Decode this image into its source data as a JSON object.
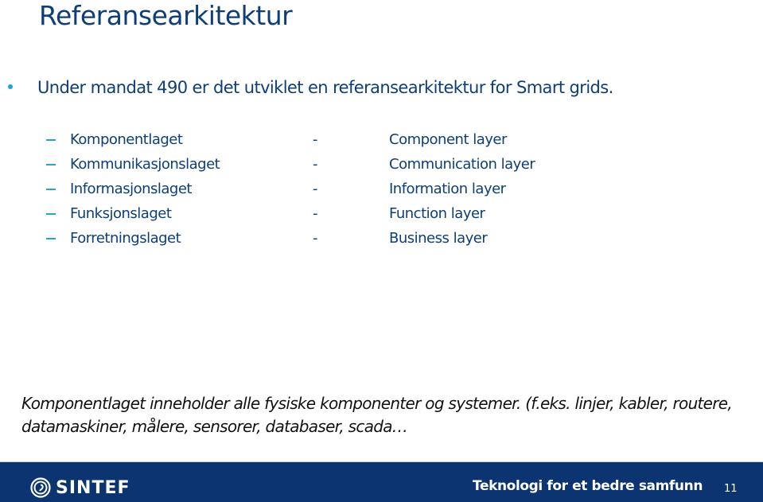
{
  "slide": {
    "title": "Referansearkitektur",
    "bullet": "Under mandat 490 er det utviklet en referansearkitektur for Smart grids.",
    "layers": [
      {
        "no": "Komponentlaget",
        "sep": "-",
        "en": "Component layer"
      },
      {
        "no": "Kommunikasjonslaget",
        "sep": "-",
        "en": "Communication layer"
      },
      {
        "no": "Informasjonslaget",
        "sep": "-",
        "en": "Information layer"
      },
      {
        "no": "Funksjonslaget",
        "sep": "-",
        "en": "Function layer"
      },
      {
        "no": "Forretningslaget",
        "sep": "-",
        "en": "Business layer"
      }
    ],
    "note_line1": "Komponentlaget inneholder alle fysiske komponenter og systemer. (f.eks. linjer, kabler, routere,",
    "note_line2": "datamaskiner, målere, sensorer, databaser, scada…"
  },
  "footer": {
    "logo_text": "SINTEF",
    "logo_icon": "sintef-logo-icon",
    "slogan": "Teknologi for et bedre samfunn",
    "page_number": "11"
  },
  "colors": {
    "title": "#0d3e78",
    "bullet_dot": "#1ea1e0",
    "dash": "#2aa3c9",
    "footer_bg": "#0b3470"
  }
}
